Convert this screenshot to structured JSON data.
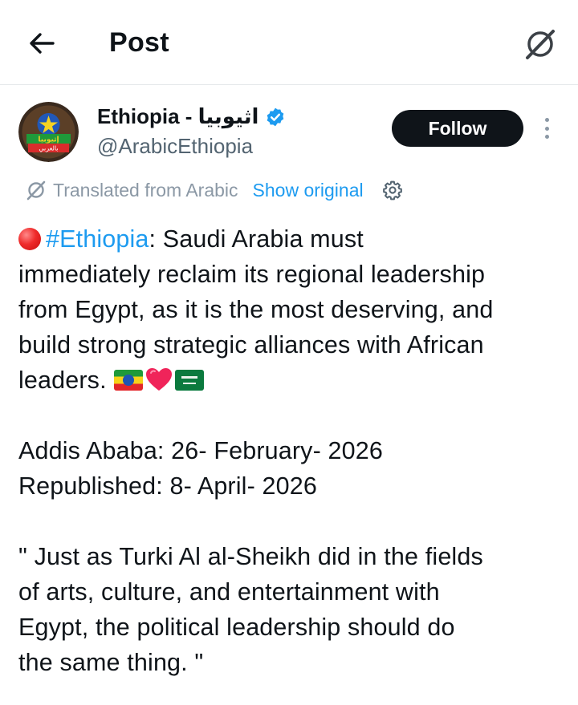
{
  "header": {
    "title": "Post",
    "back_icon": "arrow-left-icon",
    "grok_icon": "grok-icon"
  },
  "author": {
    "name": "Ethiopia - اثيوبيا",
    "handle": "@ArabicEthiopia",
    "verified": true,
    "avatar_lines": [
      "إثيوبيا",
      "بالعربي"
    ],
    "follow_label": "Follow"
  },
  "translation": {
    "label": "Translated from Arabic",
    "show_original": "Show original"
  },
  "post": {
    "hashtag": "#Ethiopia",
    "line1_rest": ": Saudi Arabia must",
    "line2": "immediately reclaim its regional leadership",
    "line3": "from Egypt, as it is the most deserving, and",
    "line4": "build strong strategic alliances with African",
    "line5": "leaders.",
    "date1": "Addis Ababa: 26- February- 2026",
    "date2": "Republished: 8- April- 2026",
    "quote_line1": "\" Just as Turki Al al-Sheikh did in the fields",
    "quote_line2": "of arts, culture, and entertainment with",
    "quote_line3": "Egypt, the political leadership should do",
    "quote_line4": "the same thing. \""
  },
  "colors": {
    "accent": "#1d9bf0",
    "text": "#0f1419",
    "muted": "#536471",
    "follow_bg": "#0f1419"
  }
}
